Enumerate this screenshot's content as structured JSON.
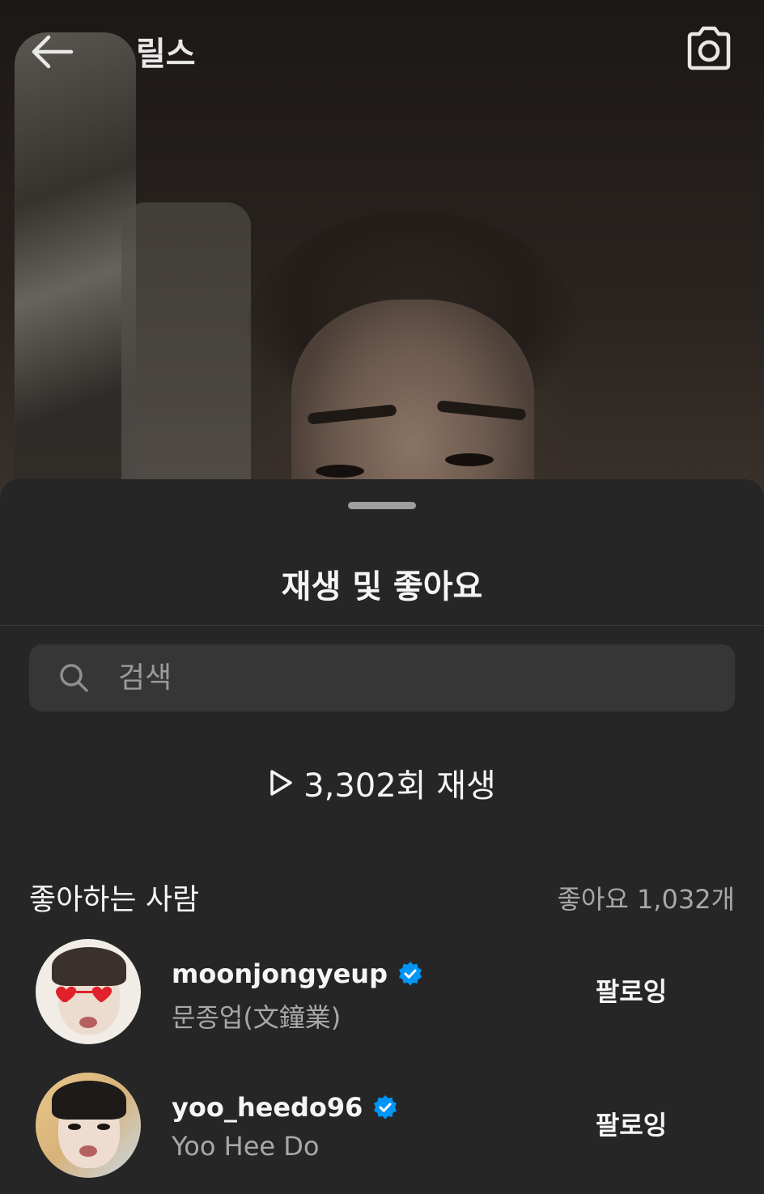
{
  "header": {
    "title": "릴스",
    "back_icon": "back-arrow-icon",
    "camera_icon": "camera-icon"
  },
  "sheet": {
    "title": "재생 및 좋아요",
    "search": {
      "placeholder": "검색",
      "value": ""
    },
    "plays_text": "3,302회 재생",
    "likers_label": "좋아하는 사람",
    "likes_count": "좋아요 1,032개",
    "users": [
      {
        "username": "moonjongyeup",
        "full_name": "문종업(文鐘業)",
        "verified": true,
        "button": "팔로잉"
      },
      {
        "username": "yoo_heedo96",
        "full_name": "Yoo Hee Do",
        "verified": true,
        "button": "팔로잉"
      }
    ]
  },
  "colors": {
    "sheet_bg": "#262626",
    "verified_blue": "#0095f6",
    "muted_text": "#a8a8a8"
  }
}
